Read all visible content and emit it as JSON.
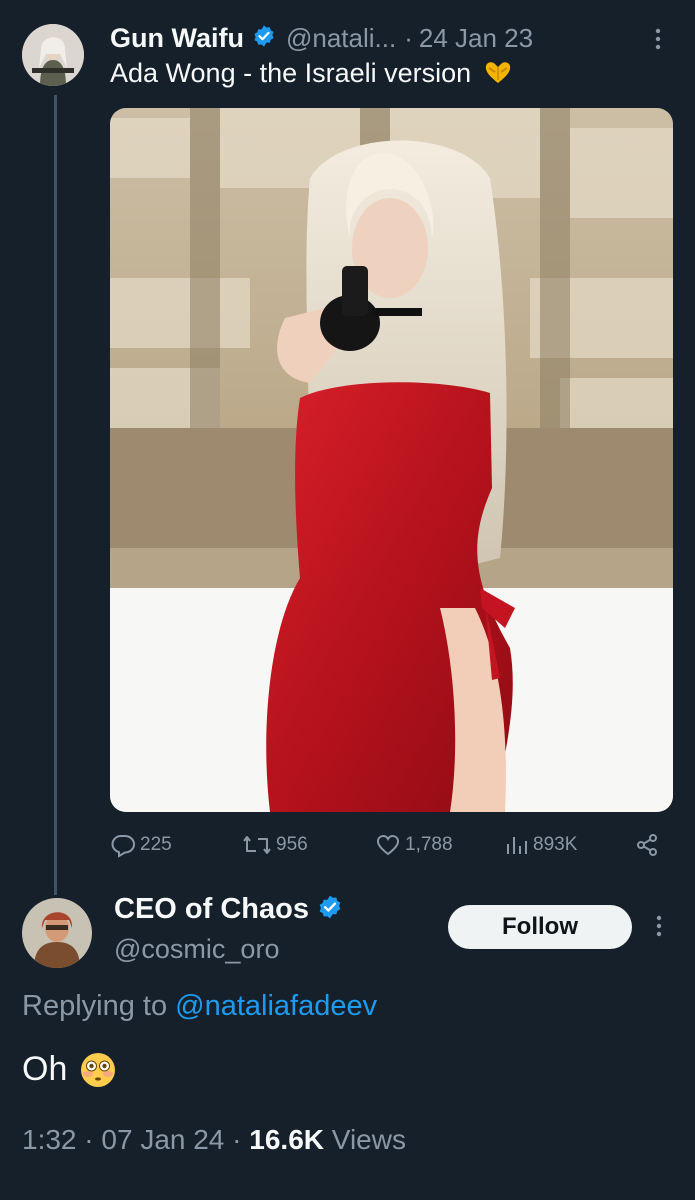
{
  "tweet": {
    "display_name": "Gun Waifu",
    "handle": "@natali...",
    "separator": "·",
    "date": "24 Jan 23",
    "text": "Ada Wong - the Israeli version",
    "emoji": "🫶",
    "stats": {
      "replies": "225",
      "retweets": "956",
      "likes": "1,788",
      "views": "893K"
    }
  },
  "reply": {
    "display_name": "CEO of Chaos",
    "handle": "@cosmic_oro",
    "follow_label": "Follow",
    "replying_prefix": "Replying to",
    "replying_handle": "@nataliafadeev",
    "text": "Oh",
    "emoji": "😳",
    "time": "1:32",
    "separator1": "·",
    "date": "07 Jan 24",
    "separator2": "·",
    "views_count": "16.6K",
    "views_label": "Views"
  },
  "colors": {
    "background": "#15202b",
    "text": "#f7f9f9",
    "muted": "#8b98a5",
    "accent": "#1d9bf0",
    "follow_button": "#eff3f4"
  }
}
